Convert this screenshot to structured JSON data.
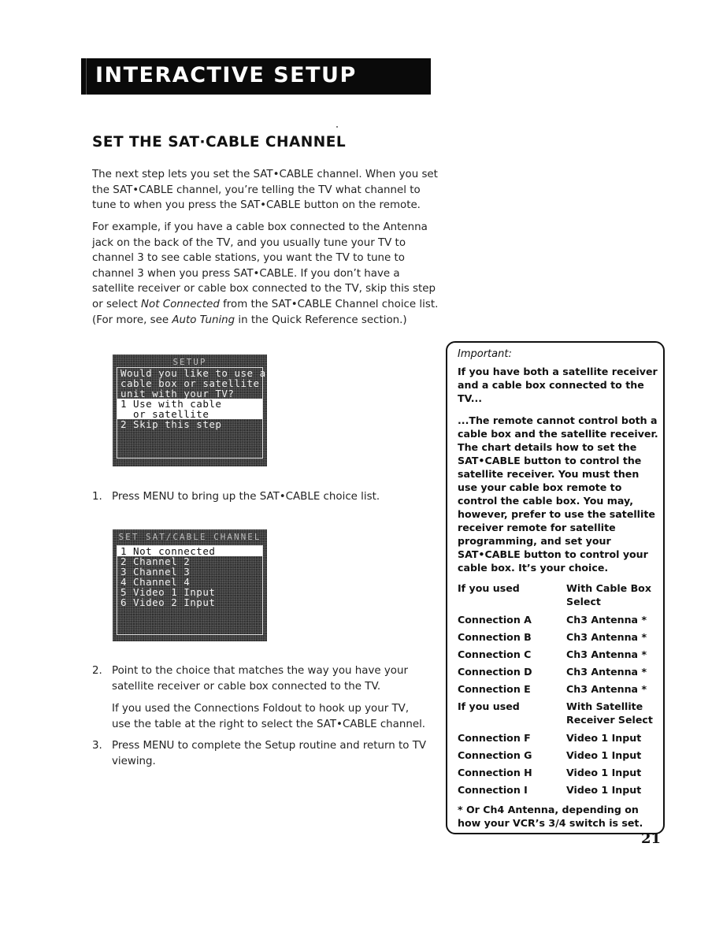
{
  "header": {
    "title": "INTERACTIVE SETUP"
  },
  "section": {
    "title": "SET THE SAT·CABLE CHANNEL"
  },
  "intro": {
    "paragraph1": "The next step lets you set the SAT•CABLE channel. When you set the SAT•CABLE channel, you’re telling the TV what channel to tune to when you press the SAT•CABLE button on the remote.",
    "paragraph2_part1": "For example, if you have a cable box connected to the Antenna jack on the back of the TV, and you usually tune your TV to channel 3 to see cable stations, you want the TV to tune to channel 3 when you press SAT•CABLE. If you don’t have a satellite receiver or cable box connected to the TV, skip this step or select ",
    "paragraph2_em1": "Not Connected",
    "paragraph2_part2": " from the SAT•CABLE Channel choice list. (For more, see ",
    "paragraph2_em2": "Auto Tuning",
    "paragraph2_part3": " in the Quick Reference section.)"
  },
  "screen1": {
    "title": "SETUP",
    "lines": [
      {
        "text": "Would you like to use a",
        "selected": false
      },
      {
        "text": "cable box or satellite",
        "selected": false
      },
      {
        "text": "unit with your TV?",
        "selected": false
      },
      {
        "text": "1 Use with cable",
        "selected": true
      },
      {
        "text": "  or satellite",
        "selected": true
      },
      {
        "text": "2 Skip this step",
        "selected": false
      }
    ]
  },
  "screen2": {
    "title": "SET SAT/CABLE CHANNEL",
    "lines": [
      {
        "text": "1 Not connected",
        "selected": true
      },
      {
        "text": "2 Channel 2",
        "selected": false
      },
      {
        "text": "3 Channel 3",
        "selected": false
      },
      {
        "text": "4 Channel 4",
        "selected": false
      },
      {
        "text": "5 Video 1 Input",
        "selected": false
      },
      {
        "text": "6 Video 2 Input",
        "selected": false
      }
    ]
  },
  "steps": [
    {
      "number": "1.",
      "text": "Press MENU to bring up the SAT•CABLE choice list."
    },
    {
      "number": "2.",
      "text": "Point to the choice that matches the way you have your satellite receiver or cable box connected to the TV.",
      "subtext": "If you used the Connections Foldout to hook up your TV, use the table at the right to select the SAT•CABLE channel."
    },
    {
      "number": "3.",
      "text": "Press MENU to complete the Setup routine and return to TV viewing."
    }
  ],
  "important": {
    "label": "Important:",
    "heading": "If you have both a satellite receiver and a cable box connected to the TV...",
    "paragraph": "...The remote cannot control both a cable box and the satellite receiver. The chart details how to set the SAT•CABLE button to control the satellite receiver. You must then use your cable box remote to control the cable box. You may, however, prefer to use the satellite receiver remote for satellite programming, and set your SAT•CABLE button to control your cable box. It’s your choice.",
    "table": {
      "header1": {
        "col1": "If you used",
        "col2": "With Cable Box Select"
      },
      "rows1": [
        {
          "col1": "Connection A",
          "col2": "Ch3 Antenna *"
        },
        {
          "col1": "Connection B",
          "col2": "Ch3 Antenna *"
        },
        {
          "col1": "Connection C",
          "col2": "Ch3 Antenna *"
        },
        {
          "col1": "Connection D",
          "col2": "Ch3 Antenna *"
        },
        {
          "col1": "Connection E",
          "col2": "Ch3 Antenna *"
        }
      ],
      "header2": {
        "col1": "If you used",
        "col2": "With Satellite Receiver Select"
      },
      "rows2": [
        {
          "col1": "Connection F",
          "col2": "Video 1 Input"
        },
        {
          "col1": "Connection G",
          "col2": "Video 1 Input"
        },
        {
          "col1": "Connection H",
          "col2": "Video 1 Input"
        },
        {
          "col1": "Connection I",
          "col2": "Video 1 Input"
        }
      ]
    },
    "footnote": "* Or Ch4 Antenna, depending on how your VCR’s 3/4 switch is set."
  },
  "page_number": "21"
}
